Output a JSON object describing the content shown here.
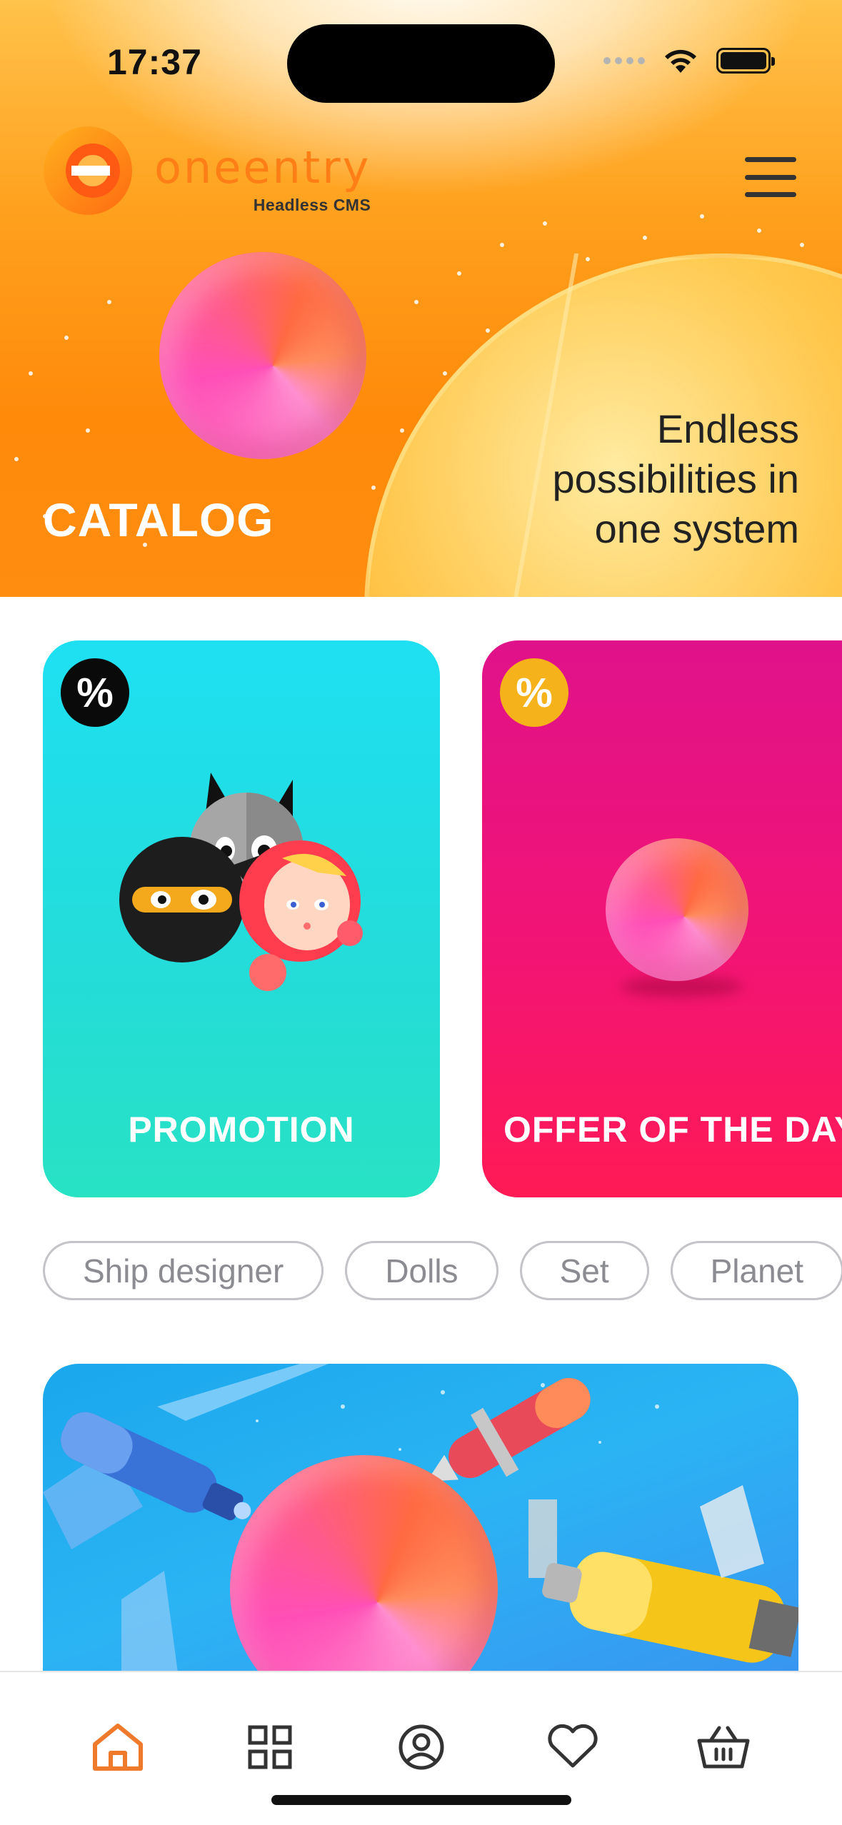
{
  "status_bar": {
    "time": "17:37"
  },
  "header": {
    "logo_word": "oneentry",
    "logo_sub": "Headless CMS",
    "menu_icon": "hamburger-menu-icon"
  },
  "hero": {
    "title": "CATALOG",
    "tagline": "Endless possibilities in one system"
  },
  "cards": [
    {
      "label": "PROMOTION",
      "badge": "%",
      "badge_color": "#0a0a0a",
      "bg": "#24dcd8"
    },
    {
      "label": "OFFER OF THE DAY",
      "badge": "%",
      "badge_color": "#f6b21a",
      "bg": "#f21475"
    }
  ],
  "chips": [
    "Ship designer",
    "Dolls",
    "Set",
    "Planet"
  ],
  "tab_bar": {
    "items": [
      {
        "icon": "home-icon",
        "active": true
      },
      {
        "icon": "grid-icon",
        "active": false
      },
      {
        "icon": "profile-icon",
        "active": false
      },
      {
        "icon": "heart-icon",
        "active": false
      },
      {
        "icon": "basket-icon",
        "active": false
      }
    ],
    "active_color": "#f07a2b",
    "inactive_color": "#333333"
  },
  "colors": {
    "brand_orange": "#ff7e16",
    "hero_bg": "#ff8d10"
  }
}
